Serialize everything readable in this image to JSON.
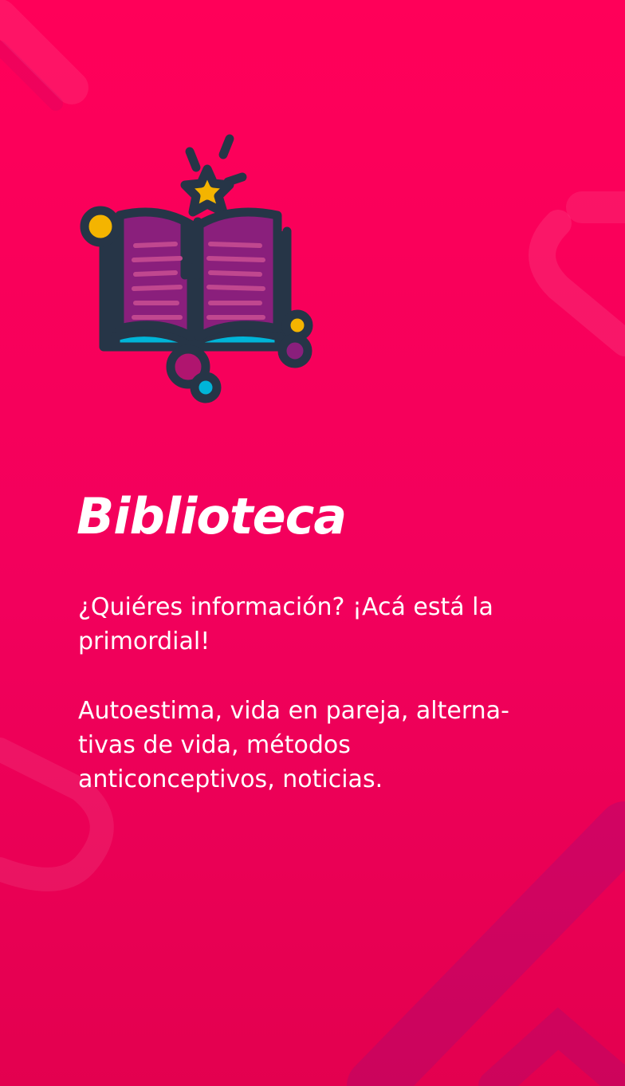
{
  "screen": {
    "title": "Biblioteca",
    "intro_text": "¿Quiéres información? ¡Acá está la\nprimordial!",
    "topics_text": "Autoestima, vida en pareja, alterna-\ntivas de vida, métodos\nanticonceptivos, noticias.",
    "icon": "open-book-with-star-icon"
  },
  "colors": {
    "background_top": "#ff0059",
    "background_bottom": "#e3004f",
    "text": "#ffffff",
    "icon_outline": "#263547",
    "icon_page": "#8a1f7c",
    "icon_accent_yellow": "#f4b400",
    "icon_accent_blue": "#00b5d8"
  }
}
